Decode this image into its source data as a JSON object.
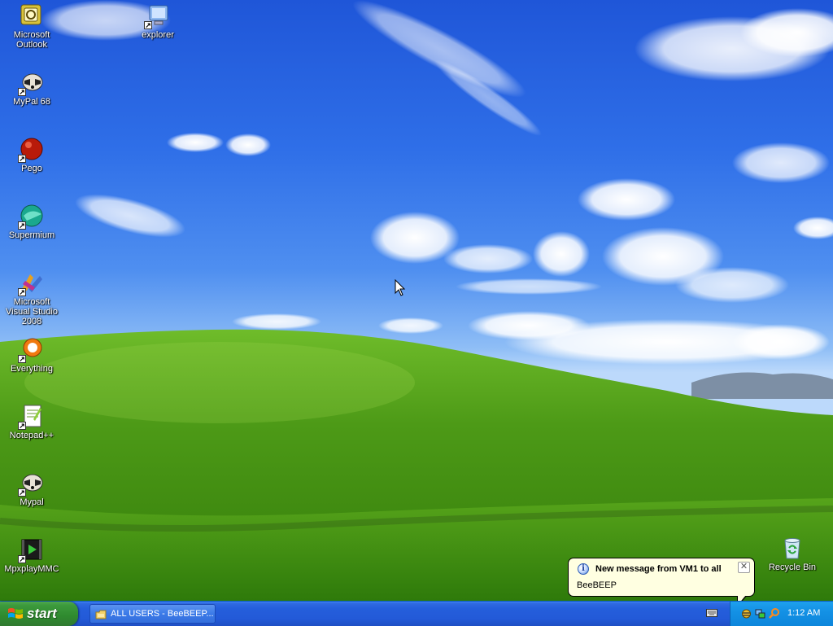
{
  "desktop": {
    "icons": [
      {
        "label": "Microsoft Outlook",
        "icon": "outlook-icon",
        "shortcut": false
      },
      {
        "label": "explorer",
        "icon": "explorer-icon",
        "shortcut": true
      },
      {
        "label": "MyPal 68",
        "icon": "mypal-icon",
        "shortcut": true
      },
      {
        "label": "Pego",
        "icon": "pego-icon",
        "shortcut": true
      },
      {
        "label": "Supermium",
        "icon": "supermium-icon",
        "shortcut": true
      },
      {
        "label": "Microsoft Visual Studio 2008",
        "icon": "visual-studio-icon",
        "shortcut": true
      },
      {
        "label": "Everything",
        "icon": "everything-icon",
        "shortcut": true
      },
      {
        "label": "Notepad++",
        "icon": "notepad-plus-plus-icon",
        "shortcut": true
      },
      {
        "label": "Mypal",
        "icon": "mypal-icon",
        "shortcut": true
      },
      {
        "label": "MpxplayMMC",
        "icon": "mpxplay-icon",
        "shortcut": true
      },
      {
        "label": "Recycle Bin",
        "icon": "recycle-bin-icon",
        "shortcut": false
      }
    ]
  },
  "balloon": {
    "title": "New message from VM1 to all",
    "body": "BeeBEEP",
    "close_glyph": "✕",
    "info_glyph": "i"
  },
  "taskbar": {
    "start_label": "start",
    "window_button": "ALL USERS - BeeBEEP...",
    "clock": "1:12 AM"
  },
  "colors": {
    "sky": "#2f6fe8",
    "hill": "#4f9a18",
    "taskbar": "#245edb",
    "start_button": "#3c9a3c",
    "tray": "#1491e5",
    "balloon": "#ffffe1"
  }
}
